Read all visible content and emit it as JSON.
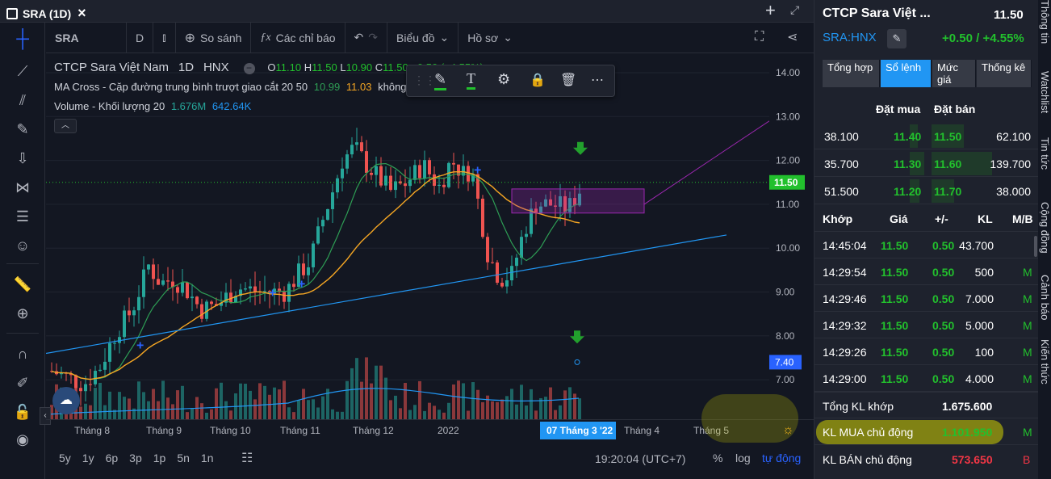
{
  "tab": {
    "title": "SRA (1D)",
    "close": "×",
    "plus": "+"
  },
  "toolbar": {
    "symbol": "SRA",
    "interval": "D",
    "compare": "So sánh",
    "indicators": "Các chỉ báo",
    "chart_type": "Biểu đồ",
    "profile": "Hồ sơ"
  },
  "legend": {
    "name": "CTCP Sara Việt Nam",
    "interval": "1D",
    "exchange": "HNX",
    "o_label": "O",
    "o": "11.10",
    "h_label": "H",
    "h": "11.50",
    "l_label": "L",
    "l": "10.90",
    "c_label": "C",
    "c": "11.50",
    "chg": "+0.50 (+4.55%)",
    "ma_label": "MA Cross - Cặp đường trung bình trượt giao cắt 20 50",
    "ma1": "10.99",
    "ma2": "11.03",
    "ma_extra": "không",
    "vol_label": "Volume - Khối lượng 20",
    "vol1": "1.676M",
    "vol2": "642.64K"
  },
  "price_axis": {
    "ticks": [
      "14.00",
      "13.00",
      "12.00",
      "11.00",
      "10.00",
      "9.00",
      "8.00",
      "7.00"
    ],
    "current": "11.50",
    "marker": "7.40",
    "current_color": "#22c02d",
    "marker_color": "#2962ff"
  },
  "time_axis": {
    "labels": [
      "Tháng 8",
      "Tháng 9",
      "Tháng 10",
      "Tháng 11",
      "Tháng 12",
      "2022",
      "Tháng 4",
      "Tháng 5"
    ],
    "highlight": "07 Tháng 3 '22"
  },
  "bottom": {
    "ranges": [
      "5y",
      "1y",
      "6p",
      "3p",
      "1p",
      "5n",
      "1n"
    ],
    "time": "19:20:04 (UTC+7)",
    "pct": "%",
    "log": "log",
    "auto": "tự động"
  },
  "panel": {
    "title": "CTCP Sara Việt ...",
    "price": "11.50",
    "ticker": "SRA:HNX",
    "change": "+0.50 / +4.55%",
    "tabs": [
      "Tổng hợp",
      "Sổ lệnh",
      "Mức giá",
      "Thống kê"
    ],
    "ob_headers": {
      "buy": "Đặt mua",
      "sell": "Đặt bán"
    },
    "orderbook": [
      {
        "bvol": "38.100",
        "bid": "11.40",
        "ask": "11.50",
        "avol": "62.100"
      },
      {
        "bvol": "35.700",
        "bid": "11.30",
        "ask": "11.60",
        "avol": "139.700"
      },
      {
        "bvol": "51.500",
        "bid": "11.20",
        "ask": "11.70",
        "avol": "38.000"
      }
    ],
    "trade_headers": {
      "time": "Khớp",
      "price": "Giá",
      "chg": "+/-",
      "vol": "KL",
      "side": "M/B"
    },
    "trades": [
      {
        "time": "14:45:04",
        "price": "11.50",
        "chg": "0.50",
        "vol": "43.700",
        "side": ""
      },
      {
        "time": "14:29:54",
        "price": "11.50",
        "chg": "0.50",
        "vol": "500",
        "side": "M"
      },
      {
        "time": "14:29:46",
        "price": "11.50",
        "chg": "0.50",
        "vol": "7.000",
        "side": "M"
      },
      {
        "time": "14:29:32",
        "price": "11.50",
        "chg": "0.50",
        "vol": "5.000",
        "side": "M"
      },
      {
        "time": "14:29:26",
        "price": "11.50",
        "chg": "0.50",
        "vol": "100",
        "side": "M"
      },
      {
        "time": "14:29:00",
        "price": "11.50",
        "chg": "0.50",
        "vol": "4.000",
        "side": "M"
      }
    ],
    "total_label": "Tổng KL khớp",
    "total": "1.675.600",
    "buy_label": "KL MUA chủ động",
    "buy": "1.101.950",
    "buy_side": "M",
    "sell_label": "KL BÁN chủ động",
    "sell": "573.650",
    "sell_side": "B"
  },
  "side_tabs": [
    "Thông tin",
    "Watchlist",
    "Tin tức",
    "Cộng đồng",
    "Cảnh báo",
    "Kiến thức"
  ],
  "colors": {
    "up": "#26a69a",
    "down": "#ef5350",
    "green": "#22c02d",
    "ma_fast": "#2e9e55",
    "ma_slow": "#f5a623",
    "trend": "#2196f3",
    "projection": "#9c27b0"
  }
}
